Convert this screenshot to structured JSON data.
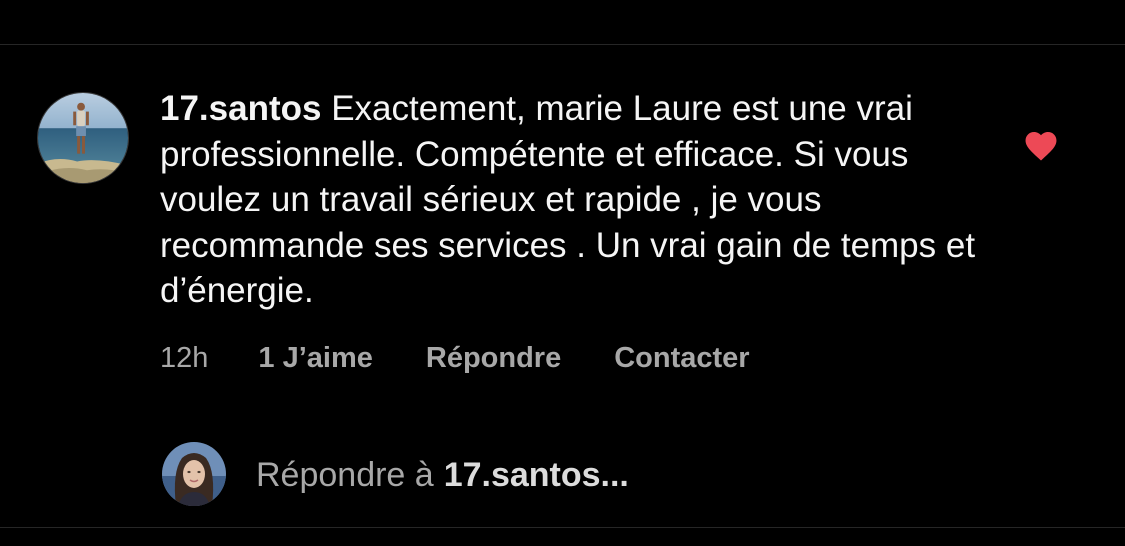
{
  "comment": {
    "username": "17.santos",
    "text": "Exactement, marie Laure est une vrai professionnelle. Compétente et efficace. Si vous voulez un travail sérieux et rapide , je vous recommande ses services . Un vrai gain de temps et d’énergie.",
    "time": "12h",
    "likes_label": "1 J’aime",
    "reply_label": "Répondre",
    "contact_label": "Contacter",
    "liked": true,
    "like_color": "#ed4956"
  },
  "reply_input": {
    "prefix": "Répondre à",
    "target": "17.santos..."
  },
  "icons": {
    "like": "heart-icon",
    "commenter_avatar": "avatar-icon",
    "my_avatar": "avatar-icon"
  }
}
